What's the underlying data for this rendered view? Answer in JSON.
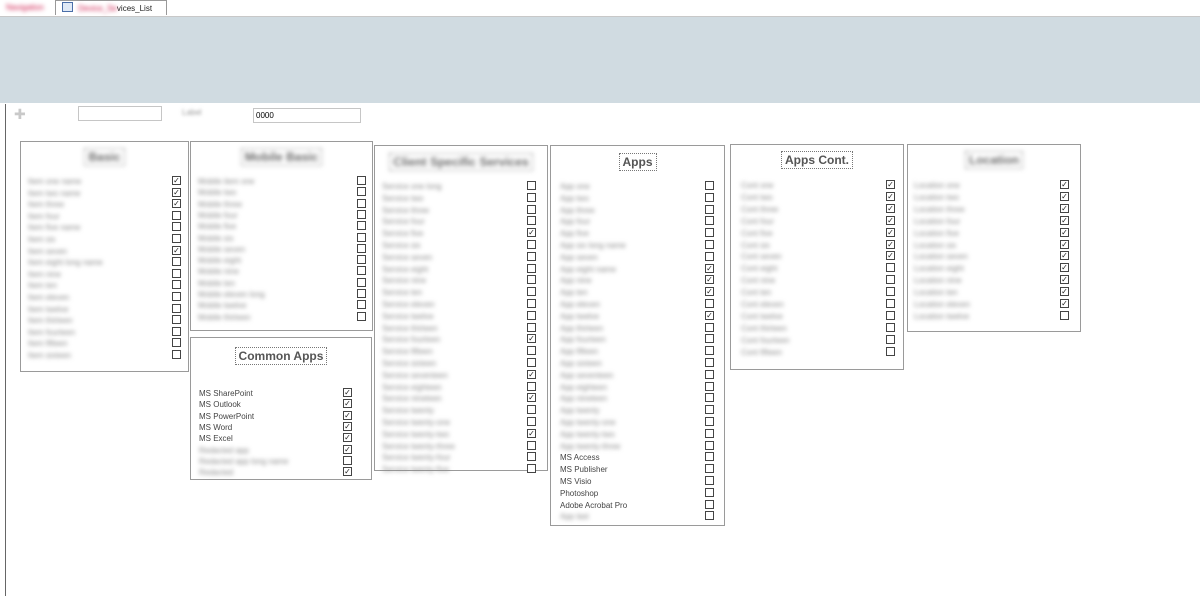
{
  "tabs": [
    {
      "label": "Navigation",
      "active": false,
      "redacted": true
    },
    {
      "label": "Services_List",
      "active": true,
      "redacted_prefix": "Device_Se",
      "visible_suffix": "vices_List"
    }
  ],
  "form_bar": {
    "record_value": "",
    "label_text": "Label",
    "field_value": "0000"
  },
  "panels": [
    {
      "id": "p1",
      "title": "Basic",
      "title_redacted": true,
      "labels_redacted": true,
      "rows": [
        {
          "label": "Item one name",
          "checked": true
        },
        {
          "label": "Item two name",
          "checked": true
        },
        {
          "label": "Item three",
          "checked": true
        },
        {
          "label": "Item four",
          "checked": false
        },
        {
          "label": "Item five name",
          "checked": false
        },
        {
          "label": "Item six",
          "checked": false
        },
        {
          "label": "Item seven",
          "checked": true
        },
        {
          "label": "Item eight long name",
          "checked": false
        },
        {
          "label": "Item nine",
          "checked": false
        },
        {
          "label": "Item ten",
          "checked": false
        },
        {
          "label": "Item eleven",
          "checked": false
        },
        {
          "label": "Item twelve",
          "checked": false
        },
        {
          "label": "Item thirteen",
          "checked": false
        },
        {
          "label": "Item fourteen",
          "checked": false
        },
        {
          "label": "Item fifteen",
          "checked": false
        },
        {
          "label": "Item sixteen",
          "checked": false
        }
      ]
    },
    {
      "id": "p2",
      "title": "Mobile Basic",
      "title_redacted": true,
      "labels_redacted": true,
      "rows": [
        {
          "label": "Mobile item one",
          "checked": false
        },
        {
          "label": "Mobile two",
          "checked": false
        },
        {
          "label": "Mobile three",
          "checked": false
        },
        {
          "label": "Mobile four",
          "checked": false
        },
        {
          "label": "Mobile five",
          "checked": false
        },
        {
          "label": "Mobile six",
          "checked": false
        },
        {
          "label": "Mobile seven",
          "checked": false
        },
        {
          "label": "Mobile eight",
          "checked": false
        },
        {
          "label": "Mobile nine",
          "checked": false
        },
        {
          "label": "Mobile ten",
          "checked": false
        },
        {
          "label": "Mobile eleven long",
          "checked": false
        },
        {
          "label": "Mobile twelve",
          "checked": false
        },
        {
          "label": "Mobile thirteen",
          "checked": false
        }
      ]
    },
    {
      "id": "p3",
      "title": "Common Apps",
      "title_redacted": false,
      "labels_redacted": false,
      "rows": [
        {
          "label": "MS SharePoint",
          "checked": true
        },
        {
          "label": "MS Outlook",
          "checked": true
        },
        {
          "label": "MS PowerPoint",
          "checked": true
        },
        {
          "label": "MS Word",
          "checked": true
        },
        {
          "label": "MS Excel",
          "checked": true
        },
        {
          "label": "Redacted app",
          "checked": true,
          "redacted": true
        },
        {
          "label": "Redacted app long name",
          "checked": false,
          "redacted": true
        },
        {
          "label": "Redacted",
          "checked": true,
          "redacted": true
        }
      ]
    },
    {
      "id": "p4",
      "title": "Client Specific Services",
      "title_redacted": true,
      "labels_redacted": true,
      "rows": [
        {
          "label": "Service one long",
          "checked": false
        },
        {
          "label": "Service two",
          "checked": false
        },
        {
          "label": "Service three",
          "checked": false
        },
        {
          "label": "Service four",
          "checked": false
        },
        {
          "label": "Service five",
          "checked": true
        },
        {
          "label": "Service six",
          "checked": false
        },
        {
          "label": "Service seven",
          "checked": false
        },
        {
          "label": "Service eight",
          "checked": false
        },
        {
          "label": "Service nine",
          "checked": false
        },
        {
          "label": "Service ten",
          "checked": false
        },
        {
          "label": "Service eleven",
          "checked": false
        },
        {
          "label": "Service twelve",
          "checked": false
        },
        {
          "label": "Service thirteen",
          "checked": false
        },
        {
          "label": "Service fourteen",
          "checked": true
        },
        {
          "label": "Service fifteen",
          "checked": false
        },
        {
          "label": "Service sixteen",
          "checked": false
        },
        {
          "label": "Service seventeen",
          "checked": true
        },
        {
          "label": "Service eighteen",
          "checked": false
        },
        {
          "label": "Service nineteen",
          "checked": true
        },
        {
          "label": "Service twenty",
          "checked": false
        },
        {
          "label": "Service twenty-one",
          "checked": false
        },
        {
          "label": "Service twenty-two",
          "checked": true
        },
        {
          "label": "Service twenty-three",
          "checked": false
        },
        {
          "label": "Service twenty-four",
          "checked": false
        },
        {
          "label": "Service twenty-five",
          "checked": false
        }
      ]
    },
    {
      "id": "p5",
      "title": "Apps",
      "title_redacted": false,
      "labels_redacted": true,
      "rows": [
        {
          "label": "App one",
          "checked": false
        },
        {
          "label": "App two",
          "checked": false
        },
        {
          "label": "App three",
          "checked": false
        },
        {
          "label": "App four",
          "checked": false
        },
        {
          "label": "App five",
          "checked": false
        },
        {
          "label": "App six long name",
          "checked": false
        },
        {
          "label": "App seven",
          "checked": false
        },
        {
          "label": "App eight name",
          "checked": true
        },
        {
          "label": "App nine",
          "checked": true
        },
        {
          "label": "App ten",
          "checked": true
        },
        {
          "label": "App eleven",
          "checked": false
        },
        {
          "label": "App twelve",
          "checked": true
        },
        {
          "label": "App thirteen",
          "checked": false
        },
        {
          "label": "App fourteen",
          "checked": false
        },
        {
          "label": "App fifteen",
          "checked": false
        },
        {
          "label": "App sixteen",
          "checked": false
        },
        {
          "label": "App seventeen",
          "checked": false
        },
        {
          "label": "App eighteen",
          "checked": false
        },
        {
          "label": "App nineteen",
          "checked": false
        },
        {
          "label": "App twenty",
          "checked": false
        },
        {
          "label": "App twenty-one",
          "checked": false
        },
        {
          "label": "App twenty-two",
          "checked": false
        },
        {
          "label": "App twenty-three",
          "checked": false
        },
        {
          "label": "MS Access",
          "checked": false,
          "redacted": false
        },
        {
          "label": "MS Publisher",
          "checked": false,
          "redacted": false
        },
        {
          "label": "MS Visio",
          "checked": false,
          "redacted": false
        },
        {
          "label": "Photoshop",
          "checked": false,
          "redacted": false
        },
        {
          "label": "Adobe Acrobat Pro",
          "checked": false,
          "redacted": false
        },
        {
          "label": "App last",
          "checked": false
        }
      ]
    },
    {
      "id": "p6",
      "title": "Apps Cont.",
      "title_redacted": false,
      "labels_redacted": true,
      "rows": [
        {
          "label": "Cont one",
          "checked": true
        },
        {
          "label": "Cont two",
          "checked": true
        },
        {
          "label": "Cont three",
          "checked": true
        },
        {
          "label": "Cont four",
          "checked": true
        },
        {
          "label": "Cont five",
          "checked": true
        },
        {
          "label": "Cont six",
          "checked": true
        },
        {
          "label": "Cont seven",
          "checked": true
        },
        {
          "label": "Cont eight",
          "checked": false
        },
        {
          "label": "Cont nine",
          "checked": false
        },
        {
          "label": "Cont ten",
          "checked": false
        },
        {
          "label": "Cont eleven",
          "checked": false
        },
        {
          "label": "Cont twelve",
          "checked": false
        },
        {
          "label": "Cont thirteen",
          "checked": false
        },
        {
          "label": "Cont fourteen",
          "checked": false
        },
        {
          "label": "Cont fifteen",
          "checked": false
        }
      ]
    },
    {
      "id": "p7",
      "title": "Location",
      "title_redacted": true,
      "labels_redacted": true,
      "rows": [
        {
          "label": "Location one",
          "checked": true
        },
        {
          "label": "Location two",
          "checked": true
        },
        {
          "label": "Location three",
          "checked": true
        },
        {
          "label": "Location four",
          "checked": true
        },
        {
          "label": "Location five",
          "checked": true
        },
        {
          "label": "Location six",
          "checked": true
        },
        {
          "label": "Location seven",
          "checked": true
        },
        {
          "label": "Location eight",
          "checked": true
        },
        {
          "label": "Location nine",
          "checked": true
        },
        {
          "label": "Location ten",
          "checked": true
        },
        {
          "label": "Location eleven",
          "checked": true
        },
        {
          "label": "Location twelve",
          "checked": false
        }
      ]
    }
  ],
  "colors": {
    "header_band": "#d0dbe1",
    "panel_border": "#9a9a9a",
    "tab_accent": "#4a6ea8"
  }
}
